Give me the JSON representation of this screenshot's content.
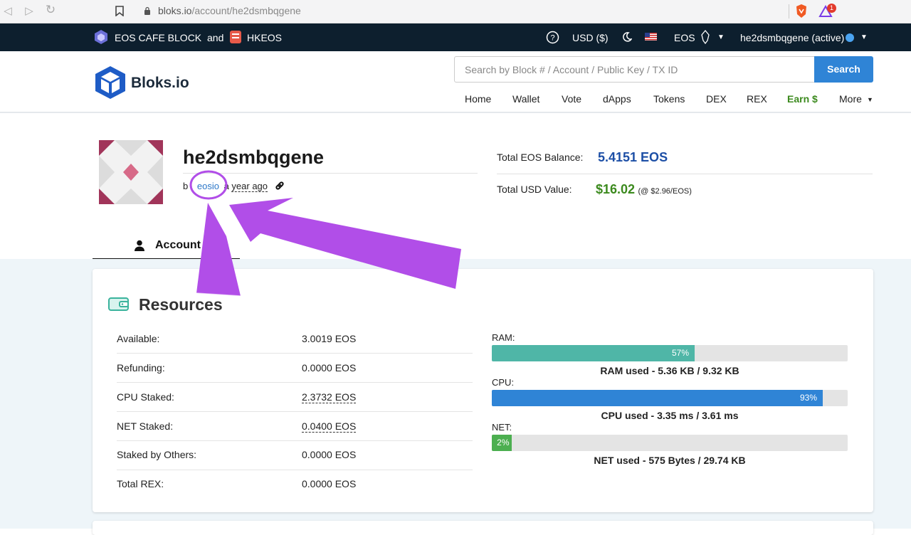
{
  "browser": {
    "url_host": "bloks.io",
    "url_path": "/account/he2dsmbqgene",
    "notification_count": "1"
  },
  "topbar": {
    "sponsor_left": "EOS CAFE BLOCK",
    "sponsor_and": "and",
    "sponsor_right": "HKEOS",
    "currency": "USD ($)",
    "chain": "EOS",
    "account_status": "he2dsmbqgene (active)"
  },
  "header": {
    "logo": "Bloks.io",
    "search_placeholder": "Search by Block # / Account / Public Key / TX ID",
    "search_button": "Search",
    "nav": [
      "Home",
      "Wallet",
      "Vote",
      "dApps",
      "Tokens",
      "DEX",
      "REX",
      "Earn $",
      "More"
    ]
  },
  "profile": {
    "account_name": "he2dsmbqgene",
    "by_prefix": "b",
    "creator": "eosio",
    "created_prefix": "a",
    "created_time": "year ago",
    "total_eos_label": "Total EOS Balance:",
    "total_eos_value": "5.4151 EOS",
    "total_usd_label": "Total USD Value:",
    "total_usd_value": "$16.02",
    "usd_rate": "(@ $2.96/EOS)",
    "tab_account": "Account"
  },
  "resources": {
    "title": "Resources",
    "rows": [
      {
        "label": "Available:",
        "value": "3.0019 EOS"
      },
      {
        "label": "Refunding:",
        "value": "0.0000 EOS"
      },
      {
        "label": "CPU Staked:",
        "value": "2.3732 EOS"
      },
      {
        "label": "NET Staked:",
        "value": "0.0400 EOS"
      },
      {
        "label": "Staked by Others:",
        "value": "0.0000 EOS"
      },
      {
        "label": "Total REX:",
        "value": "0.0000 EOS"
      }
    ],
    "bars": [
      {
        "label": "RAM:",
        "percent": 57,
        "percent_text": "57%",
        "caption": "RAM used - 5.36 KB / 9.32 KB",
        "color": "#4fb6a7"
      },
      {
        "label": "CPU:",
        "percent": 93,
        "percent_text": "93%",
        "caption": "CPU used - 3.35 ms / 3.61 ms",
        "color": "#2f84d6"
      },
      {
        "label": "NET:",
        "percent": 2,
        "percent_text": "2%",
        "caption": "NET used - 575 Bytes / 29.74 KB",
        "color": "#4caf50"
      }
    ]
  },
  "colors": {
    "accent": "#2f84d6",
    "earn_green": "#3c8a1e",
    "eos_blue": "#1d4fa6",
    "annotation": "#b14ee8"
  }
}
